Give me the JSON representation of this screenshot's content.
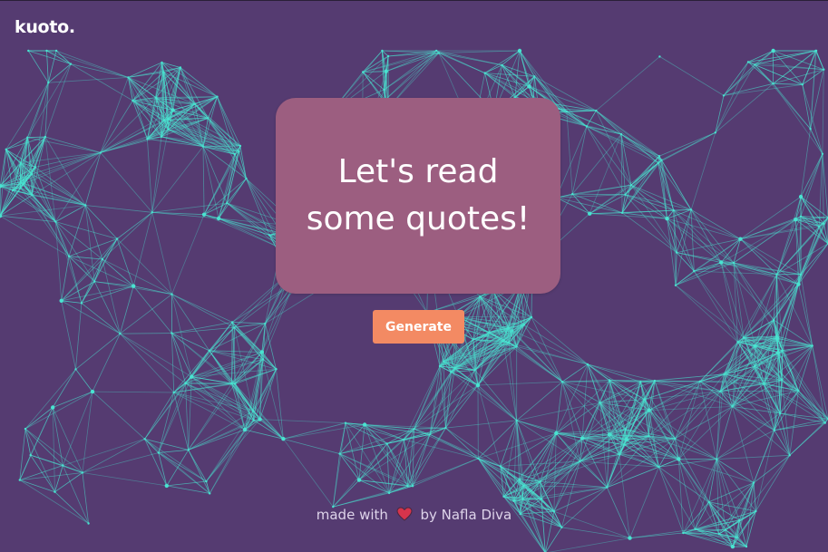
{
  "brand": {
    "name": "kuoto."
  },
  "quote": {
    "text": "Let's read some quotes!"
  },
  "actions": {
    "generate_label": "Generate"
  },
  "footer": {
    "prefix": "made with",
    "icon": "heart-icon",
    "suffix": "by Nafla Diva"
  },
  "colors": {
    "background": "#553b71",
    "network": "#49e3d0",
    "card": "#9c5e80",
    "button": "#f38a63",
    "heart": "#d6344c"
  }
}
